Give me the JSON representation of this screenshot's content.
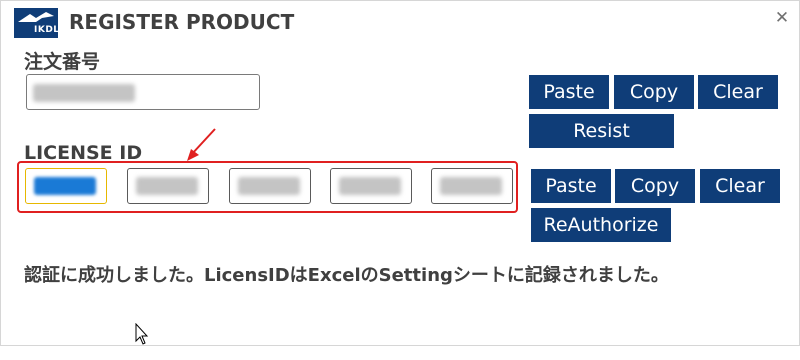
{
  "window": {
    "title": "REGISTER PRODUCT",
    "close_glyph": "✕"
  },
  "logo": {
    "text": "IKDL",
    "icon": "ikdl-logo-icon",
    "color": "#0f3d78"
  },
  "order_section": {
    "label": "注文番号",
    "input_value": "",
    "buttons": {
      "paste": "Paste",
      "copy": "Copy",
      "clear": "Clear",
      "register": "Resist"
    }
  },
  "license_section": {
    "label": "LICENSE ID",
    "fields": [
      "",
      "",
      "",
      "",
      ""
    ],
    "buttons": {
      "paste": "Paste",
      "copy": "Copy",
      "clear": "Clear",
      "reauthorize": "ReAuthorize"
    }
  },
  "status_message": "認証に成功しました。LicensIDはExcelのSettingシートに記録されました。",
  "colors": {
    "button_bg": "#0f3d78",
    "button_text": "#ffffff",
    "highlight": "#e02020",
    "text": "#404040"
  }
}
